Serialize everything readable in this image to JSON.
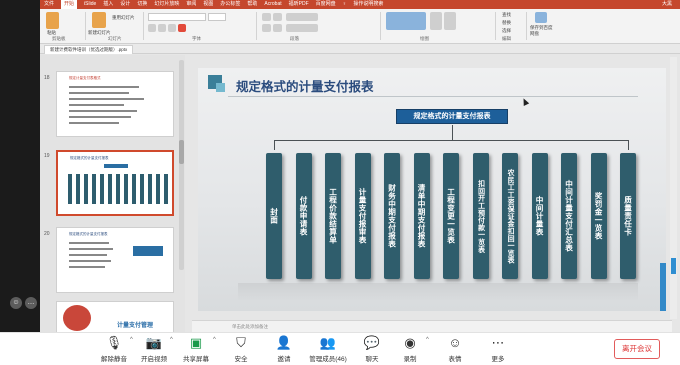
{
  "ribbon_tabs": [
    "文件",
    "开始",
    "iSlide",
    "插入",
    "设计",
    "切换",
    "幻灯片放映",
    "审阅",
    "视图",
    "办公标签",
    "帮助",
    "Acrobat",
    "福昕PDF",
    "百度网盘",
    "♀",
    "操作说明搜索"
  ],
  "user": "大黑",
  "ribbon_text": {
    "paste_group": "剪贴板",
    "slides_group": "幻灯片",
    "font_group": "字体",
    "paragraph_group": "段落",
    "drawing_group": "绘图",
    "editing_group": "编辑",
    "new_slide": "新建幻灯片",
    "paste": "粘贴",
    "reuse": "重用幻灯片",
    "find": "查找",
    "replace": "替换",
    "select": "选择",
    "save_to_baidu": "保存到百度网盘",
    "save_label": "保存"
  },
  "document_tab": "新建计费软件培训（优选过期版）.pptx",
  "thumbnails": {
    "items": [
      {
        "number": "18",
        "title": "规定计量支付表格式"
      },
      {
        "number": "19",
        "title": "规定格式的计量支付报表"
      },
      {
        "number": "20",
        "title": "规定格式的计量支付报表"
      },
      {
        "number": "21",
        "title": "计量支付管理"
      }
    ]
  },
  "slide": {
    "title": "规定格式的计量支付报表",
    "header_box": "规定格式的计量支付报表",
    "columns": [
      "封面",
      "付款申请表",
      "工程价款结算单",
      "计量支付报审表",
      "财务中期支付报表",
      "清单中期支付报表",
      "工程变更一览表",
      "扣回开工预付款一览表",
      "农民工工资保证金扣回一览表",
      "中间计量表",
      "中间计量支付汇总表",
      "奖罚金一览表",
      "质量责任卡"
    ]
  },
  "notes_placeholder": "单击此处添加备注",
  "meeting_toolbar": {
    "buttons": [
      {
        "label": "解除静音",
        "icon": "mic-muted-icon"
      },
      {
        "label": "开启视频",
        "icon": "video-off-icon"
      },
      {
        "label": "共享屏幕",
        "icon": "screen-share-icon"
      },
      {
        "label": "安全",
        "icon": "shield-icon"
      },
      {
        "label": "邀请",
        "icon": "invite-icon"
      },
      {
        "label": "管理成员(46)",
        "icon": "members-icon"
      },
      {
        "label": "聊天",
        "icon": "chat-icon"
      },
      {
        "label": "录制",
        "icon": "record-icon"
      },
      {
        "label": "表情",
        "icon": "emoji-icon"
      },
      {
        "label": "更多",
        "icon": "more-icon"
      }
    ],
    "leave": "离开会议"
  },
  "colors": {
    "ppt_red": "#c5472d",
    "column_fill": "#2f5d6c",
    "header_blue": "#1d5f9a",
    "title_blue": "#2b4c7e",
    "leave_red": "#d33333"
  }
}
